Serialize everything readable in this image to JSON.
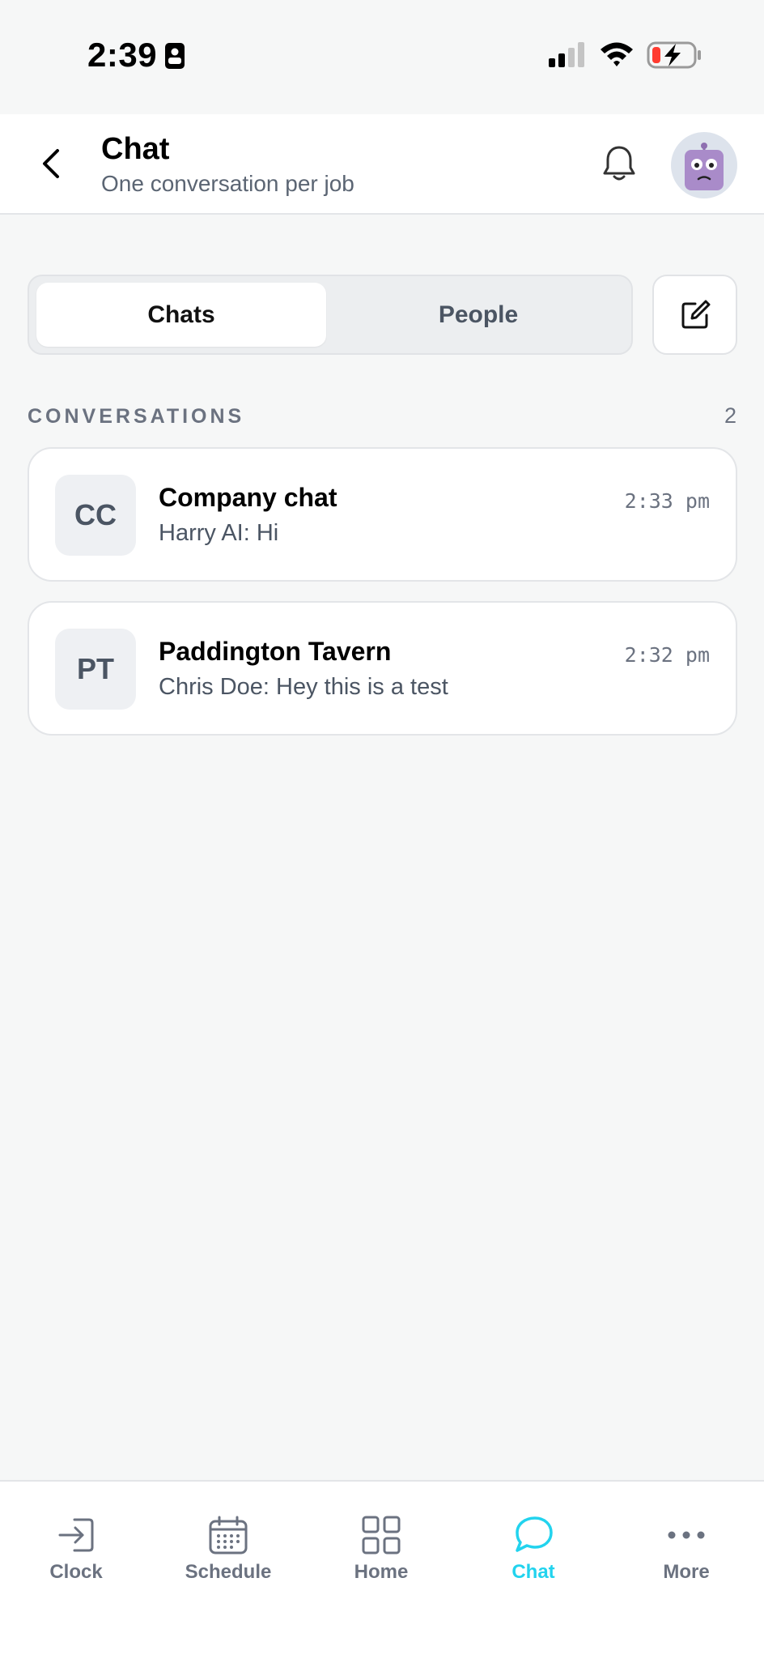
{
  "status_bar": {
    "time": "2:39"
  },
  "header": {
    "title": "Chat",
    "subtitle": "One conversation per job"
  },
  "tabs": [
    {
      "label": "Chats",
      "active": true
    },
    {
      "label": "People",
      "active": false
    }
  ],
  "section": {
    "label": "CONVERSATIONS",
    "count": "2"
  },
  "conversations": [
    {
      "initials": "CC",
      "name": "Company chat",
      "preview": "Harry AI: Hi",
      "time": "2:33 pm"
    },
    {
      "initials": "PT",
      "name": "Paddington Tavern",
      "preview": "Chris Doe: Hey this is a test",
      "time": "2:32 pm"
    }
  ],
  "bottom_nav": [
    {
      "label": "Clock",
      "icon": "clock-in-icon",
      "active": false
    },
    {
      "label": "Schedule",
      "icon": "calendar-icon",
      "active": false
    },
    {
      "label": "Home",
      "icon": "grid-icon",
      "active": false
    },
    {
      "label": "Chat",
      "icon": "chat-bubble-icon",
      "active": true
    },
    {
      "label": "More",
      "icon": "more-dots-icon",
      "active": false
    }
  ],
  "colors": {
    "accent": "#22d3ee",
    "background": "#f6f7f7",
    "muted_text": "#6b7280",
    "avatar_purple": "#a98bc9"
  }
}
